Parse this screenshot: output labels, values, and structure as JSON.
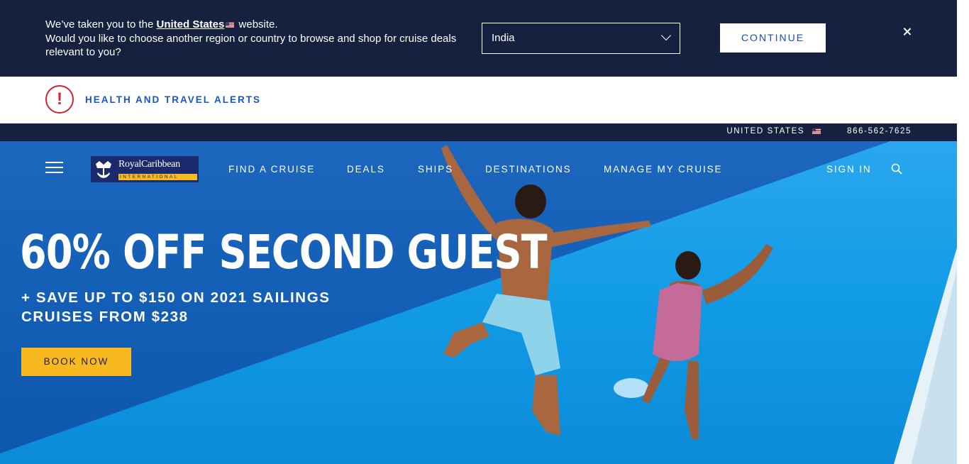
{
  "region_banner": {
    "line1_prefix": "We’ve taken you to the",
    "country_link": "United States",
    "line1_suffix": "website.",
    "line2": "Would you like to choose another region or country to browse and shop for cruise deals relevant to you?",
    "select_value": "India",
    "continue_label": "CONTINUE"
  },
  "alerts": {
    "label": "HEALTH AND TRAVEL ALERTS",
    "icon": "!"
  },
  "utility": {
    "country": "UNITED STATES",
    "phone": "866-562-7625"
  },
  "logo": {
    "name": "RoyalCaribbean",
    "subname": "INTERNATIONAL"
  },
  "nav": {
    "items": [
      "FIND A CRUISE",
      "DEALS",
      "SHIPS",
      "DESTINATIONS",
      "MANAGE MY CRUISE"
    ],
    "sign_in": "SIGN IN"
  },
  "hero": {
    "headline": "60% OFF SECOND GUEST",
    "sub1": "+ SAVE UP TO $150 ON 2021 SAILINGS",
    "sub2": "CRUISES FROM $238",
    "cta": "BOOK NOW"
  },
  "colors": {
    "navy": "#16213f",
    "accent_blue": "#1656c9",
    "alert_red": "#d3232e",
    "cta_yellow": "#f8b820"
  }
}
